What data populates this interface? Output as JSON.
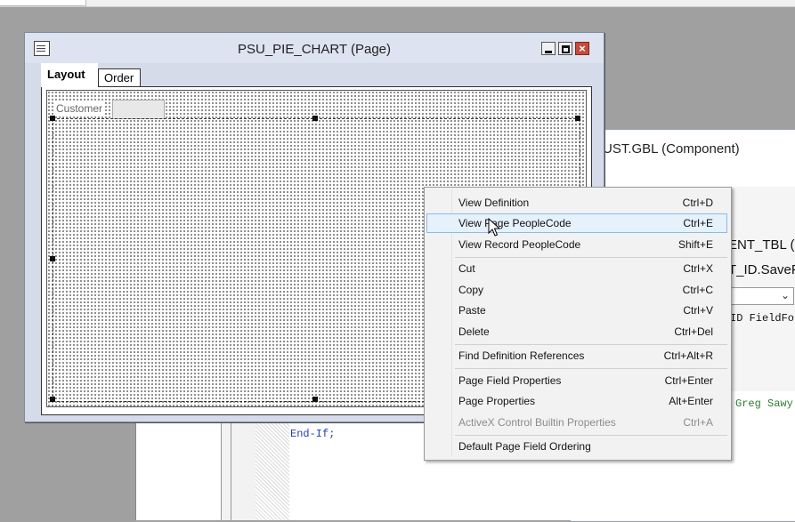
{
  "component_window": {
    "title": "UST.GBL (Component)",
    "line1": "ENT_TBL (R",
    "line2": "T_ID.SaveP",
    "dropdown_arrow": "⌄"
  },
  "code_editor": {
    "line_end_if": "End-If;",
    "line_fieldfo": "ID FieldFo",
    "line_greg": "Greg Sawy"
  },
  "page_window": {
    "title": "PSU_PIE_CHART (Page)",
    "close_glyph": "×",
    "tabs": [
      {
        "label": "Layout"
      },
      {
        "label": "Order"
      }
    ],
    "customer_label": "Customer"
  },
  "context_menu": {
    "items": [
      {
        "label": "View Definition",
        "shortcut": "Ctrl+D"
      },
      {
        "label": "View Page PeopleCode",
        "shortcut": "Ctrl+E"
      },
      {
        "label": "View Record PeopleCode",
        "shortcut": "Shift+E"
      },
      {
        "label": "Cut",
        "shortcut": "Ctrl+X"
      },
      {
        "label": "Copy",
        "shortcut": "Ctrl+C"
      },
      {
        "label": "Paste",
        "shortcut": "Ctrl+V"
      },
      {
        "label": "Delete",
        "shortcut": "Ctrl+Del"
      },
      {
        "label": "Find Definition References",
        "shortcut": "Ctrl+Alt+R"
      },
      {
        "label": "Page Field Properties",
        "shortcut": "Ctrl+Enter"
      },
      {
        "label": "Page Properties",
        "shortcut": "Alt+Enter"
      },
      {
        "label": "ActiveX Control Builtin Properties",
        "shortcut": "Ctrl+A"
      },
      {
        "label": "Default Page Field Ordering",
        "shortcut": ""
      }
    ]
  },
  "colors": {
    "highlight_bg": "#e5f1fb",
    "highlight_border": "#8bbbe6",
    "close_button": "#c9493a",
    "code_keyword": "#1f3fb8",
    "code_comment": "#2e7d32"
  }
}
